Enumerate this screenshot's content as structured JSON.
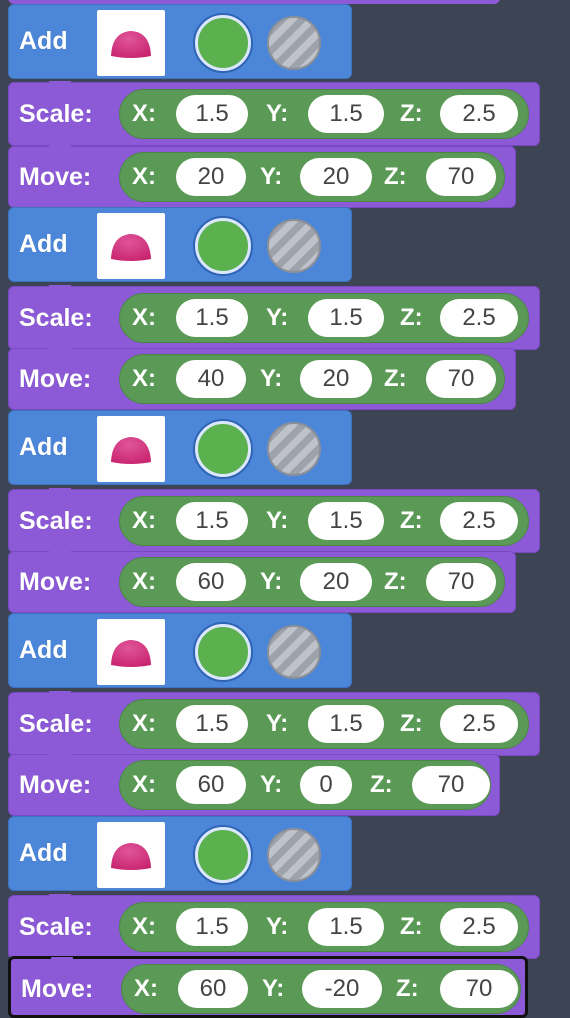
{
  "blocks": {
    "add_label": "Add",
    "scale_label": "Scale:",
    "move_label": "Move:",
    "x_label": "X:",
    "y_label": "Y:",
    "z_label": "Z:"
  },
  "sequence": [
    {
      "type": "add",
      "shape_icon": "dome-icon",
      "color": "#5cb14f",
      "material": "glass"
    },
    {
      "type": "scale",
      "x": "1.5",
      "y": "1.5",
      "z": "2.5"
    },
    {
      "type": "move",
      "x": "20",
      "y": "20",
      "z": "70"
    },
    {
      "type": "add",
      "shape_icon": "dome-icon",
      "color": "#5cb14f",
      "material": "glass"
    },
    {
      "type": "scale",
      "x": "1.5",
      "y": "1.5",
      "z": "2.5"
    },
    {
      "type": "move",
      "x": "40",
      "y": "20",
      "z": "70"
    },
    {
      "type": "add",
      "shape_icon": "dome-icon",
      "color": "#5cb14f",
      "material": "glass"
    },
    {
      "type": "scale",
      "x": "1.5",
      "y": "1.5",
      "z": "2.5"
    },
    {
      "type": "move",
      "x": "60",
      "y": "20",
      "z": "70"
    },
    {
      "type": "add",
      "shape_icon": "dome-icon",
      "color": "#5cb14f",
      "material": "glass"
    },
    {
      "type": "scale",
      "x": "1.5",
      "y": "1.5",
      "z": "2.5"
    },
    {
      "type": "move",
      "x": "60",
      "y": "0",
      "z": "70"
    },
    {
      "type": "add",
      "shape_icon": "dome-icon",
      "color": "#5cb14f",
      "material": "glass"
    },
    {
      "type": "scale",
      "x": "1.5",
      "y": "1.5",
      "z": "2.5"
    },
    {
      "type": "move",
      "x": "60",
      "y": "-20",
      "z": "70",
      "selected": true
    }
  ],
  "colors": {
    "workspace": "#3d4453",
    "add_block": "#4c86d8",
    "transform_block": "#8c5ad6",
    "vector_pill": "#5b9a56",
    "dome": "#c8246e"
  }
}
